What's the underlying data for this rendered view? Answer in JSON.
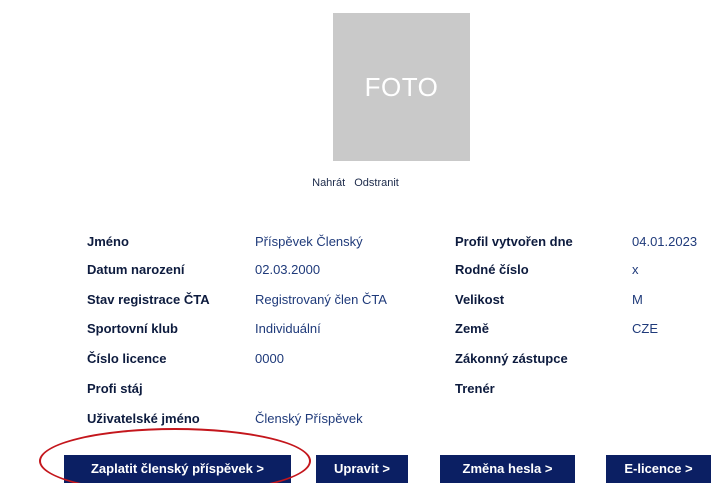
{
  "photo": {
    "placeholder": "FOTO"
  },
  "photo_actions": {
    "upload": "Nahrát",
    "remove": "Odstranit"
  },
  "left_fields": [
    {
      "label": "Jméno",
      "value": "Příspěvek Členský"
    },
    {
      "label": "Datum narození",
      "value": "02.03.2000"
    },
    {
      "label": "Stav registrace ČTA",
      "value": "Registrovaný člen ČTA"
    },
    {
      "label": "Sportovní klub",
      "value": "Individuální"
    },
    {
      "label": "Číslo licence",
      "value": "0000"
    },
    {
      "label": "Profi stáj",
      "value": ""
    },
    {
      "label": "Uživatelské jméno",
      "value": "Členský Příspěvek"
    }
  ],
  "right_fields": [
    {
      "label": "Profil vytvořen dne",
      "value": "04.01.2023"
    },
    {
      "label": "Rodné číslo",
      "value": "x"
    },
    {
      "label": "Velikost",
      "value": "M"
    },
    {
      "label": "Země",
      "value": "CZE"
    },
    {
      "label": "Zákonný zástupce",
      "value": ""
    },
    {
      "label": "Trenér",
      "value": ""
    }
  ],
  "buttons": {
    "pay": "Zaplatit členský příspěvek  >",
    "edit": "Upravit  >",
    "password": "Změna hesla  >",
    "license": "E-licence  >"
  },
  "colors": {
    "button_bg": "#0b1f63",
    "highlight_ellipse": "#c4161c"
  }
}
